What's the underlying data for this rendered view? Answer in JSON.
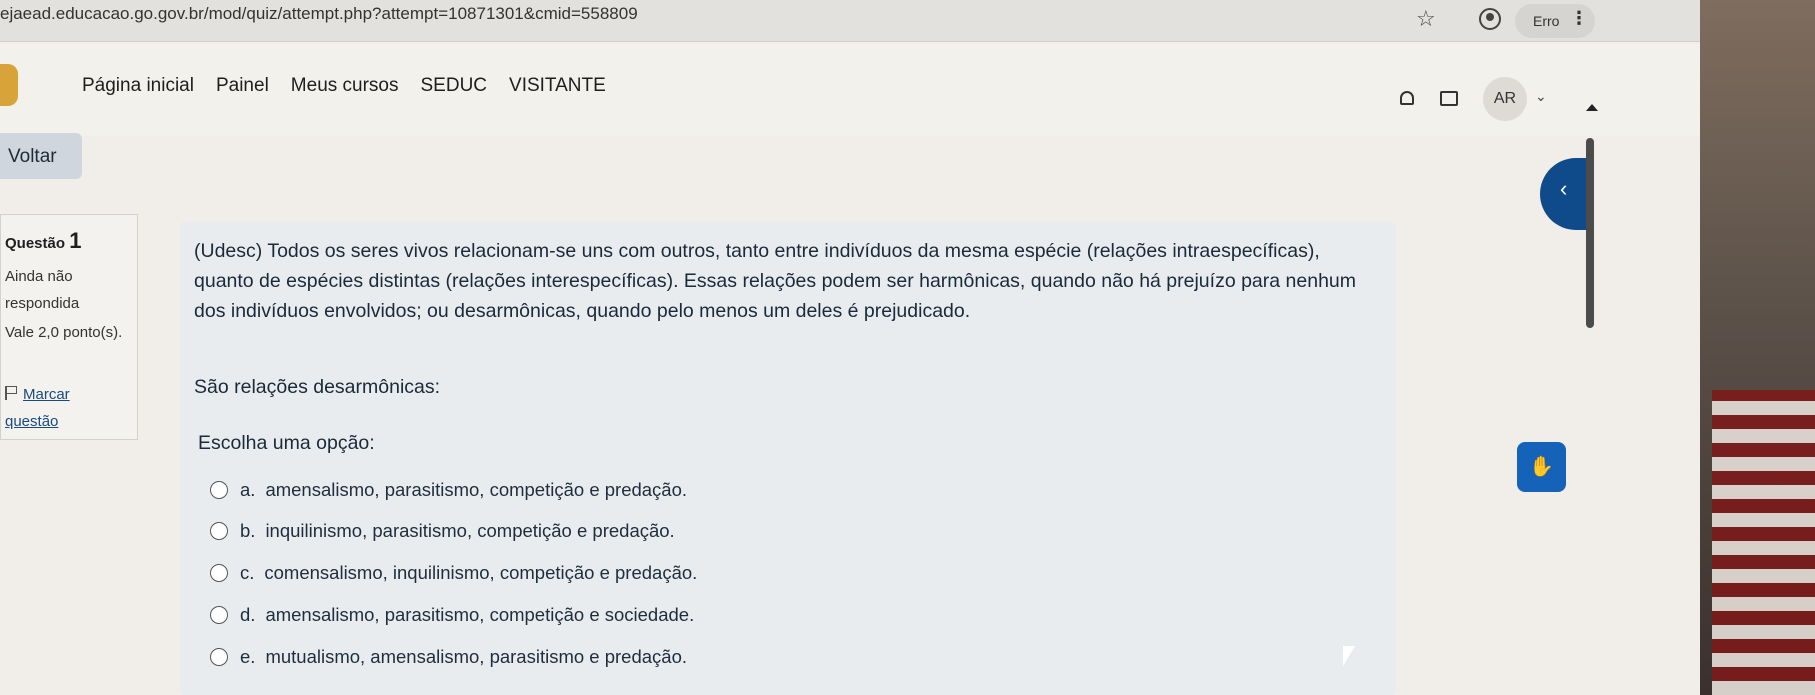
{
  "browser": {
    "url": "ejaead.educacao.go.gov.br/mod/quiz/attempt.php?attempt=10871301&cmid=558809",
    "error_label": "Erro"
  },
  "nav": {
    "links": [
      "Página inicial",
      "Painel",
      "Meus cursos",
      "SEDUC",
      "VISITANTE"
    ],
    "avatar_initials": "AR"
  },
  "back_button": "Voltar",
  "question_info": {
    "label": "Questão",
    "number": "1",
    "status": "Ainda não respondida",
    "grade": "Vale 2,0 ponto(s).",
    "flag_label": "Marcar questão"
  },
  "question": {
    "text": "(Udesc) Todos os seres vivos relacionam-se uns com outros, tanto entre indivíduos da mesma espécie (relações intraespecíficas), quanto de espécies distintas (relações interespecíficas). Essas relações podem ser harmônicas, quando não há prejuízo para nenhum dos indivíduos envolvidos; ou desarmônicas, quando pelo menos um deles é prejudicado.",
    "prompt": "São relações desarmônicas:",
    "choose_label": "Escolha uma opção:",
    "options": [
      {
        "letter": "a.",
        "text": "amensalismo, parasitismo, competição e predação."
      },
      {
        "letter": "b.",
        "text": "inquilinismo, parasitismo, competição e predação."
      },
      {
        "letter": "c.",
        "text": "comensalismo, inquilinismo, competição e predação."
      },
      {
        "letter": "d.",
        "text": "amensalismo, parasitismo, competição e sociedade."
      },
      {
        "letter": "e.",
        "text": "mutualismo, amensalismo, parasitismo e predação."
      }
    ]
  },
  "icons": {
    "star": "star-icon",
    "profile": "profile-icon",
    "menu": "kebab-menu-icon",
    "notifications": "bell-icon",
    "messages": "chat-icon",
    "drawer": "chevron-left-icon",
    "accessibility": "sign-language-icon"
  },
  "colors": {
    "drawer_toggle": "#0f4a8a",
    "accessibility_button": "#1463b8",
    "back_button": "#cfd6de",
    "question_panel": "#e9ecef"
  }
}
